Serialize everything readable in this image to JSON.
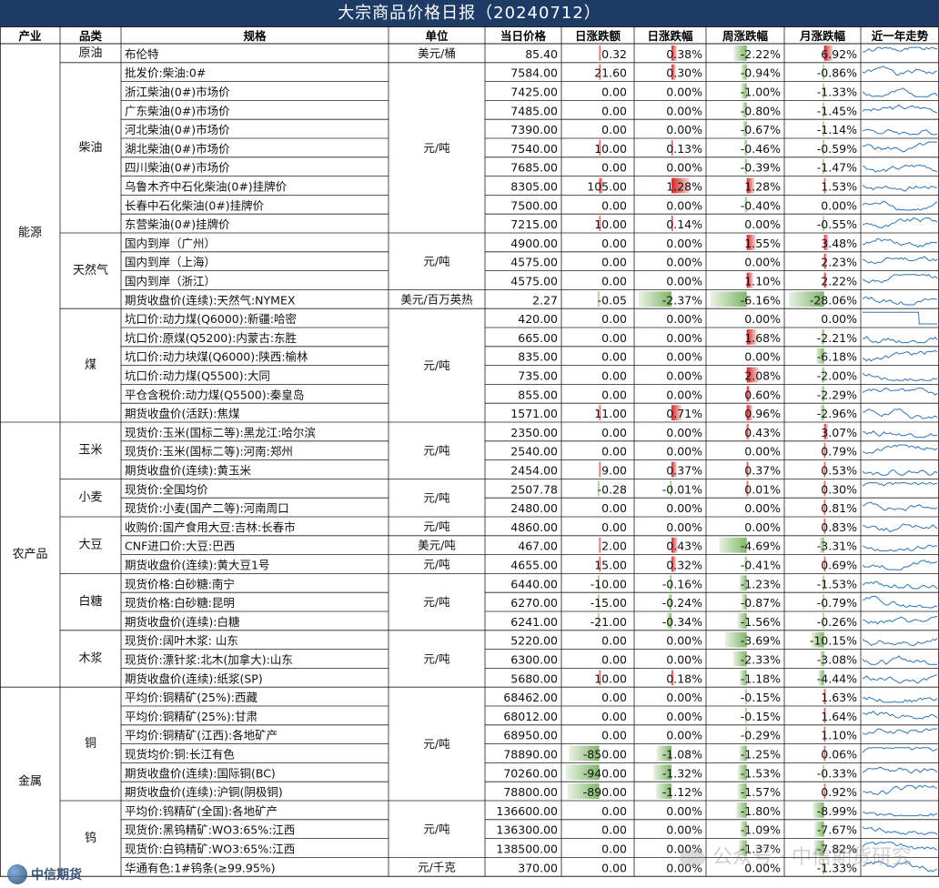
{
  "title": "大宗商品价格日报（20240712）",
  "chart_data": {
    "type": "table",
    "title": "大宗商品价格日报（20240712）",
    "headers": [
      "产业",
      "品类",
      "规格",
      "单位",
      "当日价格",
      "日涨跌额",
      "日涨跌幅",
      "周涨跌幅",
      "月涨跌幅",
      "近一年走势"
    ],
    "rows": [
      {
        "industry": "能源",
        "category": "原油",
        "spec": "布伦特",
        "unit": "美元/桶",
        "price": "85.40",
        "chg": "0.32",
        "chg_pct": "0.38%",
        "wk": "-2.22%",
        "mo": "6.92%",
        "chg_v": 0.32,
        "pct_v": 0.38,
        "wk_v": -2.22,
        "mo_v": 6.92
      },
      {
        "industry": "能源",
        "category": "柴油",
        "spec": "批发价:柴油:0#",
        "unit": "元/吨",
        "price": "7584.00",
        "chg": "21.60",
        "chg_pct": "0.30%",
        "wk": "-0.94%",
        "mo": "-0.86%",
        "chg_v": 21.6,
        "pct_v": 0.3,
        "wk_v": -0.94,
        "mo_v": -0.86
      },
      {
        "industry": "能源",
        "category": "柴油",
        "spec": "浙江柴油(0#)市场价",
        "unit": "元/吨",
        "price": "7425.00",
        "chg": "0.00",
        "chg_pct": "0.00%",
        "wk": "-1.00%",
        "mo": "-1.33%",
        "chg_v": 0,
        "pct_v": 0,
        "wk_v": -1.0,
        "mo_v": -1.33
      },
      {
        "industry": "能源",
        "category": "柴油",
        "spec": "广东柴油(0#)市场价",
        "unit": "元/吨",
        "price": "7485.00",
        "chg": "0.00",
        "chg_pct": "0.00%",
        "wk": "-0.80%",
        "mo": "-1.45%",
        "chg_v": 0,
        "pct_v": 0,
        "wk_v": -0.8,
        "mo_v": -1.45
      },
      {
        "industry": "能源",
        "category": "柴油",
        "spec": "河北柴油(0#)市场价",
        "unit": "元/吨",
        "price": "7390.00",
        "chg": "0.00",
        "chg_pct": "0.00%",
        "wk": "-0.67%",
        "mo": "-1.14%",
        "chg_v": 0,
        "pct_v": 0,
        "wk_v": -0.67,
        "mo_v": -1.14
      },
      {
        "industry": "能源",
        "category": "柴油",
        "spec": "湖北柴油(0#)市场价",
        "unit": "元/吨",
        "price": "7540.00",
        "chg": "10.00",
        "chg_pct": "0.13%",
        "wk": "-0.46%",
        "mo": "-0.59%",
        "chg_v": 10,
        "pct_v": 0.13,
        "wk_v": -0.46,
        "mo_v": -0.59
      },
      {
        "industry": "能源",
        "category": "柴油",
        "spec": "四川柴油(0#)市场价",
        "unit": "元/吨",
        "price": "7685.00",
        "chg": "0.00",
        "chg_pct": "0.00%",
        "wk": "-0.39%",
        "mo": "-1.47%",
        "chg_v": 0,
        "pct_v": 0,
        "wk_v": -0.39,
        "mo_v": -1.47
      },
      {
        "industry": "能源",
        "category": "柴油",
        "spec": "乌鲁木齐中石化柴油(0#)挂牌价",
        "unit": "元/吨",
        "price": "8305.00",
        "chg": "105.00",
        "chg_pct": "1.28%",
        "wk": "1.28%",
        "mo": "1.53%",
        "chg_v": 105,
        "pct_v": 1.28,
        "wk_v": 1.28,
        "mo_v": 1.53
      },
      {
        "industry": "能源",
        "category": "柴油",
        "spec": "长春中石化柴油(0#)挂牌价",
        "unit": "元/吨",
        "price": "7500.00",
        "chg": "0.00",
        "chg_pct": "0.00%",
        "wk": "-0.40%",
        "mo": "0.00%",
        "chg_v": 0,
        "pct_v": 0,
        "wk_v": -0.4,
        "mo_v": 0
      },
      {
        "industry": "能源",
        "category": "柴油",
        "spec": "东营柴油(0#)挂牌价",
        "unit": "元/吨",
        "price": "7215.00",
        "chg": "10.00",
        "chg_pct": "0.14%",
        "wk": "0.00%",
        "mo": "-0.55%",
        "chg_v": 10,
        "pct_v": 0.14,
        "wk_v": 0,
        "mo_v": -0.55
      },
      {
        "industry": "能源",
        "category": "天然气",
        "spec": "国内到岸（广州）",
        "unit": "元/吨",
        "price": "4900.00",
        "chg": "0.00",
        "chg_pct": "0.00%",
        "wk": "1.55%",
        "mo": "3.48%",
        "chg_v": 0,
        "pct_v": 0,
        "wk_v": 1.55,
        "mo_v": 3.48
      },
      {
        "industry": "能源",
        "category": "天然气",
        "spec": "国内到岸（上海）",
        "unit": "元/吨",
        "price": "4575.00",
        "chg": "0.00",
        "chg_pct": "0.00%",
        "wk": "0.00%",
        "mo": "2.23%",
        "chg_v": 0,
        "pct_v": 0,
        "wk_v": 0,
        "mo_v": 2.23
      },
      {
        "industry": "能源",
        "category": "天然气",
        "spec": "国内到岸（浙江）",
        "unit": "元/吨",
        "price": "4575.00",
        "chg": "0.00",
        "chg_pct": "0.00%",
        "wk": "1.10%",
        "mo": "2.22%",
        "chg_v": 0,
        "pct_v": 0,
        "wk_v": 1.1,
        "mo_v": 2.22
      },
      {
        "industry": "能源",
        "category": "天然气",
        "spec": "期货收盘价(连续):天然气:NYMEX",
        "unit": "美元/百万英热",
        "price": "2.27",
        "chg": "-0.05",
        "chg_pct": "-2.37%",
        "wk": "-6.16%",
        "mo": "-28.06%",
        "chg_v": -0.05,
        "pct_v": -2.37,
        "wk_v": -6.16,
        "mo_v": -28.06
      },
      {
        "industry": "能源",
        "category": "煤",
        "spec": "坑口价:动力煤(Q6000):新疆:哈密",
        "unit": "元/吨",
        "price": "420.00",
        "chg": "0.00",
        "chg_pct": "0.00%",
        "wk": "0.00%",
        "mo": "0.00%",
        "chg_v": 0,
        "pct_v": 0,
        "wk_v": 0,
        "mo_v": 0
      },
      {
        "industry": "能源",
        "category": "煤",
        "spec": "坑口价:原煤(Q5200):内蒙古:东胜",
        "unit": "元/吨",
        "price": "665.00",
        "chg": "0.00",
        "chg_pct": "0.00%",
        "wk": "1.68%",
        "mo": "-2.21%",
        "chg_v": 0,
        "pct_v": 0,
        "wk_v": 1.68,
        "mo_v": -2.21
      },
      {
        "industry": "能源",
        "category": "煤",
        "spec": "坑口价:动力块煤(Q6000):陕西:榆林",
        "unit": "元/吨",
        "price": "835.00",
        "chg": "0.00",
        "chg_pct": "0.00%",
        "wk": "0.00%",
        "mo": "-6.18%",
        "chg_v": 0,
        "pct_v": 0,
        "wk_v": 0,
        "mo_v": -6.18
      },
      {
        "industry": "能源",
        "category": "煤",
        "spec": "坑口价:动力煤(Q5500):大同",
        "unit": "元/吨",
        "price": "735.00",
        "chg": "0.00",
        "chg_pct": "0.00%",
        "wk": "2.08%",
        "mo": "-2.00%",
        "chg_v": 0,
        "pct_v": 0,
        "wk_v": 2.08,
        "mo_v": -2.0
      },
      {
        "industry": "能源",
        "category": "煤",
        "spec": "平仓含税价:动力煤(Q5500):秦皇岛",
        "unit": "元/吨",
        "price": "855.00",
        "chg": "0.00",
        "chg_pct": "0.00%",
        "wk": "0.60%",
        "mo": "-2.29%",
        "chg_v": 0,
        "pct_v": 0,
        "wk_v": 0.6,
        "mo_v": -2.29
      },
      {
        "industry": "能源",
        "category": "煤",
        "spec": "期货收盘价(活跃):焦煤",
        "unit": "元/吨",
        "price": "1571.00",
        "chg": "11.00",
        "chg_pct": "0.71%",
        "wk": "0.96%",
        "mo": "-2.96%",
        "chg_v": 11,
        "pct_v": 0.71,
        "wk_v": 0.96,
        "mo_v": -2.96
      },
      {
        "industry": "农产品",
        "category": "玉米",
        "spec": "现货价:玉米(国标二等):黑龙江:哈尔滨",
        "unit": "元/吨",
        "price": "2350.00",
        "chg": "0.00",
        "chg_pct": "0.00%",
        "wk": "0.43%",
        "mo": "3.07%",
        "chg_v": 0,
        "pct_v": 0,
        "wk_v": 0.43,
        "mo_v": 3.07
      },
      {
        "industry": "农产品",
        "category": "玉米",
        "spec": "现货价:玉米(国标二等):河南:郑州",
        "unit": "元/吨",
        "price": "2540.00",
        "chg": "0.00",
        "chg_pct": "0.00%",
        "wk": "0.00%",
        "mo": "0.79%",
        "chg_v": 0,
        "pct_v": 0,
        "wk_v": 0,
        "mo_v": 0.79
      },
      {
        "industry": "农产品",
        "category": "玉米",
        "spec": "期货收盘价(连续):黄玉米",
        "unit": "元/吨",
        "price": "2454.00",
        "chg": "9.00",
        "chg_pct": "0.37%",
        "wk": "0.37%",
        "mo": "0.53%",
        "chg_v": 9,
        "pct_v": 0.37,
        "wk_v": 0.37,
        "mo_v": 0.53
      },
      {
        "industry": "农产品",
        "category": "小麦",
        "spec": "现货价:全国均价",
        "unit": "元/吨",
        "price": "2507.78",
        "chg": "-0.28",
        "chg_pct": "-0.01%",
        "wk": "0.01%",
        "mo": "0.30%",
        "chg_v": -0.28,
        "pct_v": -0.01,
        "wk_v": 0.01,
        "mo_v": 0.3
      },
      {
        "industry": "农产品",
        "category": "小麦",
        "spec": "现货价:小麦(国产二等):河南周口",
        "unit": "元/吨",
        "price": "2480.00",
        "chg": "0.00",
        "chg_pct": "0.00%",
        "wk": "0.00%",
        "mo": "0.81%",
        "chg_v": 0,
        "pct_v": 0,
        "wk_v": 0,
        "mo_v": 0.81
      },
      {
        "industry": "农产品",
        "category": "大豆",
        "spec": "收购价:国产食用大豆:吉林:长春市",
        "unit": "元/吨",
        "price": "4860.00",
        "chg": "0.00",
        "chg_pct": "0.00%",
        "wk": "0.00%",
        "mo": "0.83%",
        "chg_v": 0,
        "pct_v": 0,
        "wk_v": 0,
        "mo_v": 0.83
      },
      {
        "industry": "农产品",
        "category": "大豆",
        "spec": "CNF进口价:大豆:巴西",
        "unit": "美元/吨",
        "price": "467.00",
        "chg": "2.00",
        "chg_pct": "0.43%",
        "wk": "-4.69%",
        "mo": "-3.31%",
        "chg_v": 2,
        "pct_v": 0.43,
        "wk_v": -4.69,
        "mo_v": -3.31
      },
      {
        "industry": "农产品",
        "category": "大豆",
        "spec": "期货收盘价(连续):黄大豆1号",
        "unit": "元/吨",
        "price": "4655.00",
        "chg": "15.00",
        "chg_pct": "0.32%",
        "wk": "-0.41%",
        "mo": "0.69%",
        "chg_v": 15,
        "pct_v": 0.32,
        "wk_v": -0.41,
        "mo_v": 0.69
      },
      {
        "industry": "农产品",
        "category": "白糖",
        "spec": "现货价格:白砂糖:南宁",
        "unit": "元/吨",
        "price": "6440.00",
        "chg": "-10.00",
        "chg_pct": "-0.16%",
        "wk": "-1.23%",
        "mo": "-1.53%",
        "chg_v": -10,
        "pct_v": -0.16,
        "wk_v": -1.23,
        "mo_v": -1.53
      },
      {
        "industry": "农产品",
        "category": "白糖",
        "spec": "现货价格:白砂糖:昆明",
        "unit": "元/吨",
        "price": "6270.00",
        "chg": "-15.00",
        "chg_pct": "-0.24%",
        "wk": "-0.87%",
        "mo": "-0.79%",
        "chg_v": -15,
        "pct_v": -0.24,
        "wk_v": -0.87,
        "mo_v": -0.79
      },
      {
        "industry": "农产品",
        "category": "白糖",
        "spec": "期货收盘价(连续):白糖",
        "unit": "元/吨",
        "price": "6241.00",
        "chg": "-21.00",
        "chg_pct": "-0.34%",
        "wk": "-1.56%",
        "mo": "-0.26%",
        "chg_v": -21,
        "pct_v": -0.34,
        "wk_v": -1.56,
        "mo_v": -0.26
      },
      {
        "industry": "农产品",
        "category": "木浆",
        "spec": "现货价:阔叶木浆: 山东",
        "unit": "元/吨",
        "price": "5220.00",
        "chg": "0.00",
        "chg_pct": "0.00%",
        "wk": "-3.69%",
        "mo": "-10.15%",
        "chg_v": 0,
        "pct_v": 0,
        "wk_v": -3.69,
        "mo_v": -10.15
      },
      {
        "industry": "农产品",
        "category": "木浆",
        "spec": "现货价:漂针浆:北木(加拿大):山东",
        "unit": "元/吨",
        "price": "6300.00",
        "chg": "0.00",
        "chg_pct": "0.00%",
        "wk": "-2.33%",
        "mo": "-3.08%",
        "chg_v": 0,
        "pct_v": 0,
        "wk_v": -2.33,
        "mo_v": -3.08
      },
      {
        "industry": "农产品",
        "category": "木浆",
        "spec": "期货收盘价(连续):纸浆(SP)",
        "unit": "元/吨",
        "price": "5680.00",
        "chg": "10.00",
        "chg_pct": "0.18%",
        "wk": "-1.18%",
        "mo": "-4.44%",
        "chg_v": 10,
        "pct_v": 0.18,
        "wk_v": -1.18,
        "mo_v": -4.44
      },
      {
        "industry": "金属",
        "category": "铜",
        "spec": "平均价:铜精矿(25%):西藏",
        "unit": "元/吨",
        "price": "68462.00",
        "chg": "0.00",
        "chg_pct": "0.00%",
        "wk": "-0.15%",
        "mo": "1.63%",
        "chg_v": 0,
        "pct_v": 0,
        "wk_v": -0.15,
        "mo_v": 1.63
      },
      {
        "industry": "金属",
        "category": "铜",
        "spec": "平均价:铜精矿(25%):甘肃",
        "unit": "元/吨",
        "price": "68012.00",
        "chg": "0.00",
        "chg_pct": "0.00%",
        "wk": "-0.15%",
        "mo": "1.64%",
        "chg_v": 0,
        "pct_v": 0,
        "wk_v": -0.15,
        "mo_v": 1.64
      },
      {
        "industry": "金属",
        "category": "铜",
        "spec": "平均价:铜精矿(江西):各地矿产",
        "unit": "元/吨",
        "price": "68950.00",
        "chg": "0.00",
        "chg_pct": "0.00%",
        "wk": "-0.29%",
        "mo": "1.10%",
        "chg_v": 0,
        "pct_v": 0,
        "wk_v": -0.29,
        "mo_v": 1.1
      },
      {
        "industry": "金属",
        "category": "铜",
        "spec": "现货均价:铜:长江有色",
        "unit": "元/吨",
        "price": "78890.00",
        "chg": "-850.00",
        "chg_pct": "-1.08%",
        "wk": "-1.25%",
        "mo": "0.06%",
        "chg_v": -850,
        "pct_v": -1.08,
        "wk_v": -1.25,
        "mo_v": 0.06
      },
      {
        "industry": "金属",
        "category": "铜",
        "spec": "期货收盘价(连续):国际铜(BC)",
        "unit": "元/吨",
        "price": "70260.00",
        "chg": "-940.00",
        "chg_pct": "-1.32%",
        "wk": "-1.53%",
        "mo": "-0.33%",
        "chg_v": -940,
        "pct_v": -1.32,
        "wk_v": -1.53,
        "mo_v": -0.33
      },
      {
        "industry": "金属",
        "category": "铜",
        "spec": "期货收盘价(连续):沪铜(阴极铜)",
        "unit": "元/吨",
        "price": "78800.00",
        "chg": "-890.00",
        "chg_pct": "-1.12%",
        "wk": "-1.57%",
        "mo": "0.92%",
        "chg_v": -890,
        "pct_v": -1.12,
        "wk_v": -1.57,
        "mo_v": 0.92
      },
      {
        "industry": "金属",
        "category": "钨",
        "spec": "平均价:钨精矿(全国):各地矿产",
        "unit": "元/吨",
        "price": "136600.00",
        "chg": "0.00",
        "chg_pct": "0.00%",
        "wk": "-1.80%",
        "mo": "-8.99%",
        "chg_v": 0,
        "pct_v": 0,
        "wk_v": -1.8,
        "mo_v": -8.99
      },
      {
        "industry": "金属",
        "category": "钨",
        "spec": "现货价:黑钨精矿:WO3:65%:江西",
        "unit": "元/吨",
        "price": "136300.00",
        "chg": "0.00",
        "chg_pct": "0.00%",
        "wk": "-1.09%",
        "mo": "-7.67%",
        "chg_v": 0,
        "pct_v": 0,
        "wk_v": -1.09,
        "mo_v": -7.67
      },
      {
        "industry": "金属",
        "category": "钨",
        "spec": "现货价:白钨精矿:WO3:65%:江西",
        "unit": "元/吨",
        "price": "138500.00",
        "chg": "0.00",
        "chg_pct": "0.00%",
        "wk": "-1.37%",
        "mo": "-7.82%",
        "chg_v": 0,
        "pct_v": 0,
        "wk_v": -1.37,
        "mo_v": -7.82
      },
      {
        "industry": "金属",
        "category": "钨",
        "spec": "华通有色:1#钨条(≥99.95%)",
        "unit": "元/千克",
        "price": "370.00",
        "chg": "0.00",
        "chg_pct": "0.00%",
        "wk": "0.00%",
        "mo": "-1.33%",
        "chg_v": 0,
        "pct_v": 0,
        "wk_v": 0,
        "mo_v": -1.33
      }
    ]
  },
  "colors": {
    "header_bg": "#1d3b64",
    "header_text": "#ffffff",
    "grid": "#1f1f1f",
    "bar_negative": "#6aa84f",
    "bar_positive": "#cc0000",
    "sparkline": "#2e75b6",
    "text": "#111111"
  },
  "footer": {
    "logo_text": "中信期货",
    "watermark": "公众号 · 中信期货研究"
  }
}
